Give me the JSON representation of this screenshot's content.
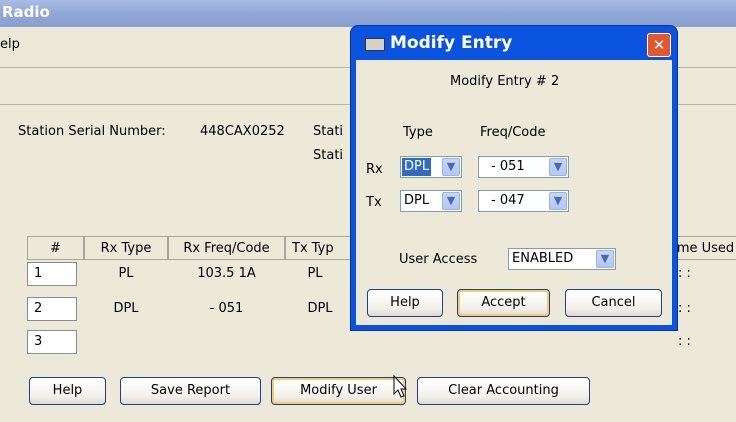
{
  "window": {
    "title": "Radio"
  },
  "menu": {
    "help": "elp"
  },
  "station": {
    "serial_label": "Station Serial Number:",
    "serial_value": "448CAX0252",
    "label2": "Stati",
    "label3": "Stati"
  },
  "table": {
    "headers": [
      "#",
      "Rx Type",
      "Rx Freq/Code",
      "Tx Typ",
      "me Used"
    ],
    "rows": [
      {
        "num": "1",
        "rx_type": "PL",
        "rx_freq": "103.5  1A",
        "tx_type": "PL",
        "time": ": :"
      },
      {
        "num": "2",
        "rx_type": "DPL",
        "rx_freq": "-  051",
        "tx_type": "DPL",
        "time": ": :"
      },
      {
        "num": "3",
        "rx_type": "",
        "rx_freq": "",
        "tx_type": "",
        "time": ": :"
      }
    ]
  },
  "buttons": {
    "help": "Help",
    "save_report": "Save Report",
    "modify_user": "Modify User",
    "clear_accounting": "Clear Accounting"
  },
  "dialog": {
    "title": "Modify Entry",
    "subtitle": "Modify Entry #  2",
    "col_type": "Type",
    "col_freq": "Freq/Code",
    "rx_label": "Rx",
    "tx_label": "Tx",
    "rx_type": "DPL",
    "rx_code": "-  051",
    "tx_type": "DPL",
    "tx_code": "-  047",
    "user_access_label": "User Access",
    "user_access_value": "ENABLED",
    "help": "Help",
    "accept": "Accept",
    "cancel": "Cancel"
  },
  "icons": {
    "dropdown": "chevron-down-icon",
    "close": "close-icon",
    "window": "window-icon",
    "cursor": "mouse-pointer-icon"
  },
  "colors": {
    "dialog_frame": "#0a53e0",
    "selection": "#316ac5",
    "close_button": "#e3572d"
  }
}
